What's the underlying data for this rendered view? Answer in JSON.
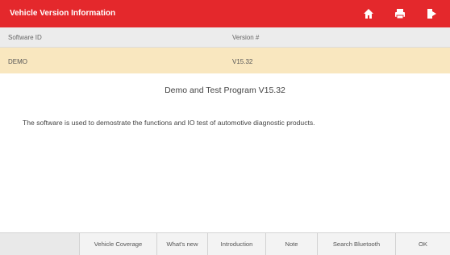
{
  "header": {
    "title": "Vehicle Version Information",
    "icons": [
      "home-icon",
      "print-icon",
      "exit-icon"
    ],
    "bar_color": "#e4282c"
  },
  "table": {
    "columns": [
      "Software ID",
      "Version #"
    ],
    "rows": [
      [
        "DEMO",
        "V15.32"
      ]
    ],
    "selected_row_color": "#f9e7bf"
  },
  "content": {
    "program_title": "Demo and Test Program V15.32",
    "description": "The software is used to demostrate the functions and IO test of automotive diagnostic products."
  },
  "footer": {
    "buttons": [
      "Vehicle Coverage",
      "What's new",
      "Introduction",
      "Note",
      "Search Bluetooth",
      "OK"
    ]
  }
}
